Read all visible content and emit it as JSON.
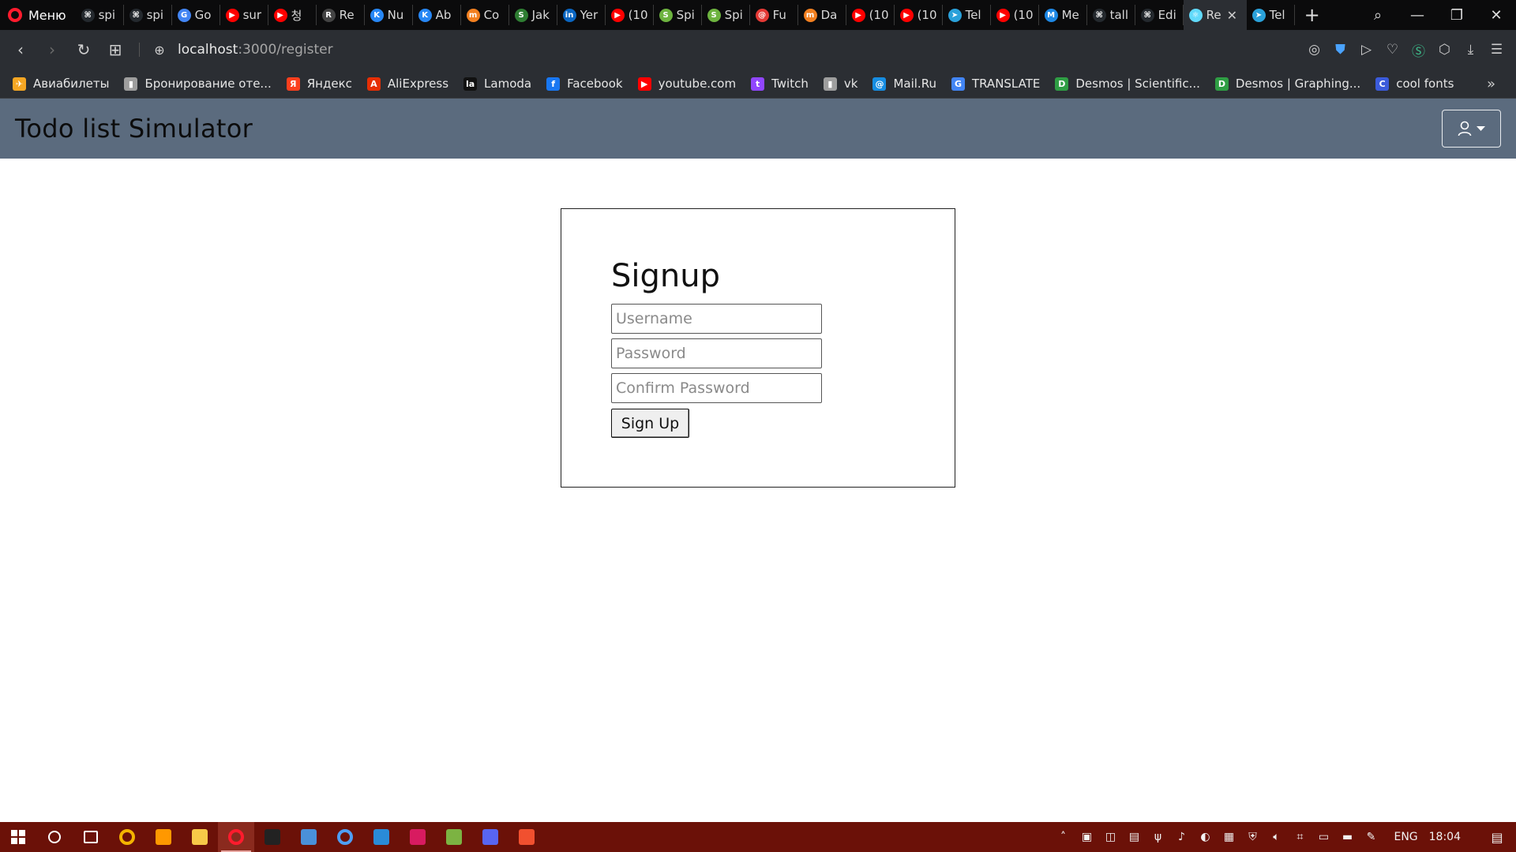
{
  "browser": {
    "menu_label": "Меню",
    "tabs": [
      {
        "label": "spi",
        "color": "#24292e",
        "glyph": "⌘"
      },
      {
        "label": "spi",
        "color": "#24292e",
        "glyph": "⌘"
      },
      {
        "label": "Go",
        "color": "#4285f4",
        "glyph": "G"
      },
      {
        "label": "sur",
        "color": "#ff0000",
        "glyph": "▶"
      },
      {
        "label": "청",
        "color": "#ff0000",
        "glyph": "▶"
      },
      {
        "label": "Re",
        "color": "#444444",
        "glyph": "R"
      },
      {
        "label": "Nu",
        "color": "#2787f5",
        "glyph": "K"
      },
      {
        "label": "Ab",
        "color": "#2787f5",
        "glyph": "K"
      },
      {
        "label": "Co",
        "color": "#f38020",
        "glyph": "m"
      },
      {
        "label": "Jak",
        "color": "#2e7d32",
        "glyph": "S"
      },
      {
        "label": "Yer",
        "color": "#0a66c2",
        "glyph": "in"
      },
      {
        "label": "(10",
        "color": "#ff0000",
        "glyph": "▶"
      },
      {
        "label": "Spi",
        "color": "#6db33f",
        "glyph": "S"
      },
      {
        "label": "Spi",
        "color": "#6db33f",
        "glyph": "S"
      },
      {
        "label": "Fu",
        "color": "#e53935",
        "glyph": "@"
      },
      {
        "label": "Da",
        "color": "#f38020",
        "glyph": "m"
      },
      {
        "label": "(10",
        "color": "#ff0000",
        "glyph": "▶"
      },
      {
        "label": "(10",
        "color": "#ff0000",
        "glyph": "▶"
      },
      {
        "label": "Tel",
        "color": "#2aa1da",
        "glyph": "➤"
      },
      {
        "label": "(10",
        "color": "#ff0000",
        "glyph": "▶"
      },
      {
        "label": "Me",
        "color": "#1e88e5",
        "glyph": "M"
      },
      {
        "label": "tall",
        "color": "#24292e",
        "glyph": "⌘"
      },
      {
        "label": "Edi",
        "color": "#24292e",
        "glyph": "⌘"
      }
    ],
    "active_tab": {
      "label": "Re",
      "color": "#61dafb",
      "glyph": "⚛"
    },
    "last_tab": {
      "label": "Tel",
      "color": "#2aa1da",
      "glyph": "➤"
    },
    "url_host": "localhost",
    "url_path": ":3000/register"
  },
  "bookmarks": [
    {
      "label": "Авиабилеты",
      "color": "#f5a623",
      "glyph": "✈"
    },
    {
      "label": "Бронирование оте...",
      "color": "#9e9e9e",
      "glyph": "▮"
    },
    {
      "label": "Яндекс",
      "color": "#fc3f1d",
      "glyph": "Я"
    },
    {
      "label": "AliExpress",
      "color": "#e62e04",
      "glyph": "A"
    },
    {
      "label": "Lamoda",
      "color": "#111111",
      "glyph": "la"
    },
    {
      "label": "Facebook",
      "color": "#1877f2",
      "glyph": "f"
    },
    {
      "label": "youtube.com",
      "color": "#ff0000",
      "glyph": "▶"
    },
    {
      "label": "Twitch",
      "color": "#9146ff",
      "glyph": "t"
    },
    {
      "label": "vk",
      "color": "#9e9e9e",
      "glyph": "▮"
    },
    {
      "label": "Mail.Ru",
      "color": "#168de2",
      "glyph": "@"
    },
    {
      "label": "TRANSLATE",
      "color": "#4285f4",
      "glyph": "G"
    },
    {
      "label": "Desmos | Scientific...",
      "color": "#2f9e44",
      "glyph": "D"
    },
    {
      "label": "Desmos | Graphing...",
      "color": "#2f9e44",
      "glyph": "D"
    },
    {
      "label": "cool fonts",
      "color": "#3b5bdb",
      "glyph": "C"
    }
  ],
  "app": {
    "brand": "Todo list Simulator"
  },
  "signup": {
    "title": "Signup",
    "username_placeholder": "Username",
    "password_placeholder": "Password",
    "confirm_placeholder": "Confirm Password",
    "submit_label": "Sign Up"
  },
  "taskbar": {
    "apps": [
      {
        "name": "search",
        "color": "#6b1108"
      },
      {
        "name": "task-view",
        "color": "#6b1108"
      },
      {
        "name": "chrome",
        "color": "#f4b400"
      },
      {
        "name": "sublime",
        "color": "#ff9800"
      },
      {
        "name": "file-explorer",
        "color": "#f7c948"
      },
      {
        "name": "opera",
        "color": "#ff1b2d"
      },
      {
        "name": "terminal",
        "color": "#222222"
      },
      {
        "name": "photos",
        "color": "#4a90d9"
      },
      {
        "name": "chromium",
        "color": "#4e9ef5"
      },
      {
        "name": "vscode",
        "color": "#2a8bd8"
      },
      {
        "name": "intellij",
        "color": "#d81b60"
      },
      {
        "name": "notepad",
        "color": "#7cb342"
      },
      {
        "name": "discord",
        "color": "#5865f2"
      },
      {
        "name": "git",
        "color": "#f1502f"
      }
    ],
    "language": "ENG",
    "time": "18:04"
  }
}
